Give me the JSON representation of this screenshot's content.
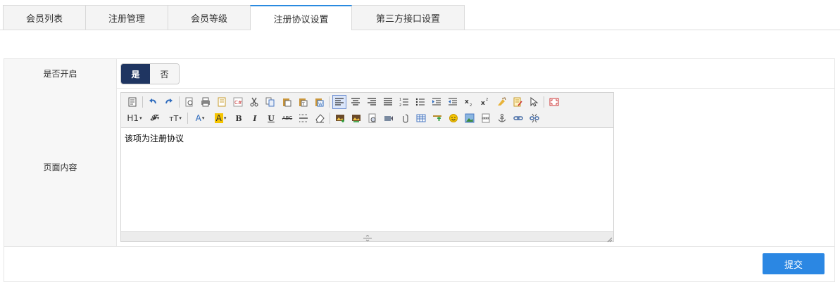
{
  "tabs": [
    {
      "label": "会员列表",
      "active": false
    },
    {
      "label": "注册管理",
      "active": false
    },
    {
      "label": "会员等级",
      "active": false
    },
    {
      "label": "注册协议设置",
      "active": true
    },
    {
      "label": "第三方接口设置",
      "active": false
    }
  ],
  "form": {
    "enabled_label": "是否开启",
    "toggle": {
      "yes": "是",
      "no": "否",
      "selected": "是"
    },
    "content_label": "页面内容",
    "editor_content": "该项为注册协议",
    "toolbar": {
      "heading": "H1",
      "font_family": "𝓕",
      "font_size": "тT",
      "font_color": "A",
      "bg_color": "A",
      "bold": "B",
      "italic": "I",
      "underline": "U",
      "strike": "ABC"
    },
    "submit_label": "提交"
  },
  "colors": {
    "accent": "#2a8ae0",
    "toggle_on_bg": "#1f3561",
    "submit_bg": "#2b87e3"
  }
}
